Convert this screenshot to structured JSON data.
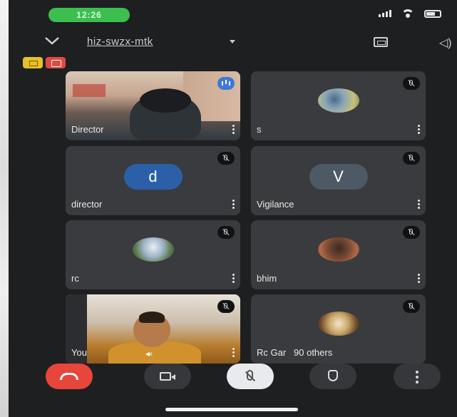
{
  "status_bar": {
    "time": "12:26"
  },
  "top_bar": {
    "meeting_code": "hiz-swzx-mtk"
  },
  "tiles": [
    {
      "name": "Director",
      "type": "video",
      "mic": "active"
    },
    {
      "name": "s",
      "type": "avatar-photo",
      "mic": "muted"
    },
    {
      "name": "director",
      "type": "letter",
      "letter": "d",
      "color": "#2b5fa8",
      "mic": "muted"
    },
    {
      "name": "Vigilance",
      "type": "letter",
      "letter": "V",
      "color": "#4d5a66",
      "mic": "muted"
    },
    {
      "name": "rc",
      "type": "avatar-photo",
      "mic": "muted"
    },
    {
      "name": "bhim",
      "type": "avatar-photo",
      "mic": "muted"
    },
    {
      "name": "You",
      "type": "video",
      "mic": "muted"
    },
    {
      "name": "Rc Gar",
      "extra": "90 others",
      "type": "avatar-photo",
      "mic": "muted"
    }
  ],
  "controls": {
    "end_call": {
      "icon": "phone-hangup-icon",
      "color": "#e8453c"
    },
    "camera": {
      "icon": "camera-icon"
    },
    "mic": {
      "icon": "mic-off-icon",
      "color": "#e8eaed"
    },
    "raise_hand": {
      "icon": "hand-icon"
    },
    "more": {
      "icon": "more-vert-icon"
    }
  }
}
